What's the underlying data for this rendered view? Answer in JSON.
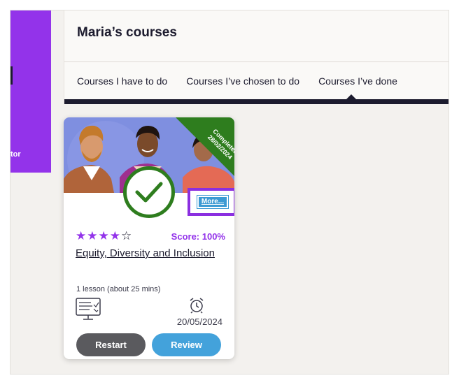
{
  "left_panel": {
    "partial_text": "tor",
    "color": "#9333ea"
  },
  "header": {
    "title": "Maria’s courses",
    "tabs": [
      {
        "label": "Courses I have to do",
        "active": false
      },
      {
        "label": "Courses I’ve chosen to do",
        "active": false
      },
      {
        "label": "Courses I’ve done",
        "active": true
      }
    ]
  },
  "course_card": {
    "ribbon": {
      "label": "Completed",
      "date": "28/02/2024",
      "color": "#2e7d1e"
    },
    "status_icon": "check-icon",
    "more_button": "More...",
    "rating": {
      "filled": 4,
      "max": 5
    },
    "score": "Score: 100%",
    "title": "Equity, Diversity and Inclusion",
    "lessons": "1 lesson (about 25 mins)",
    "date": "20/05/2024",
    "buttons": {
      "restart": "Restart",
      "review": "Review"
    }
  }
}
